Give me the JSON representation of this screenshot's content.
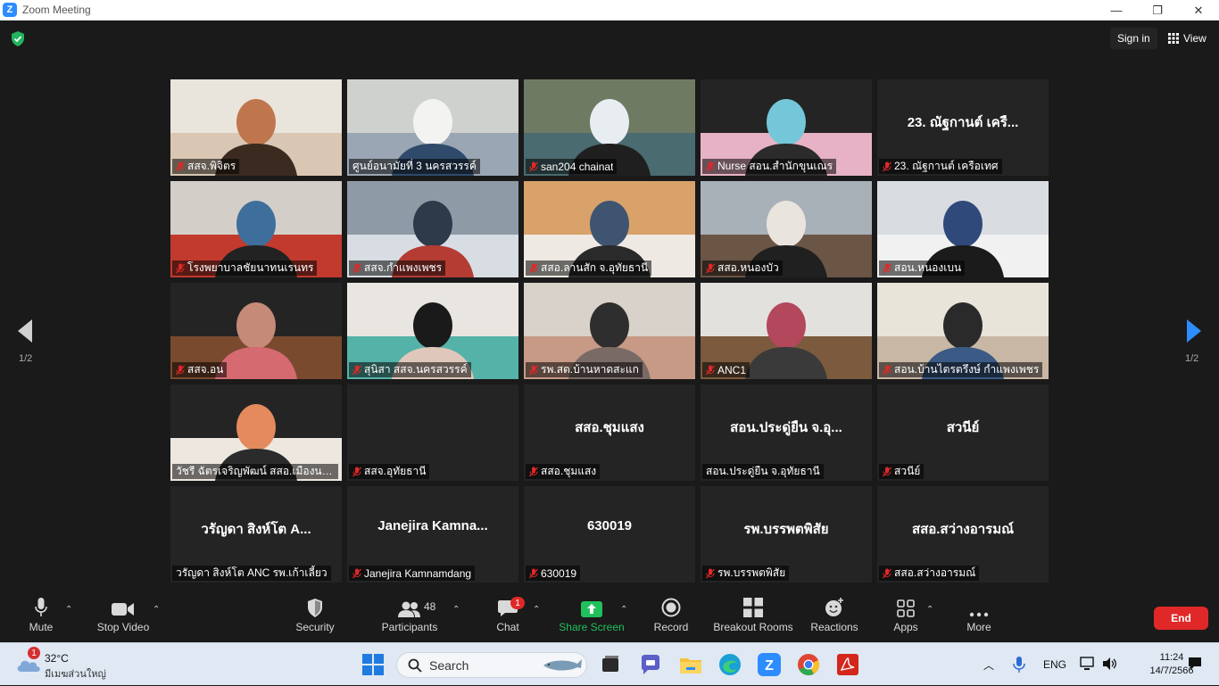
{
  "window": {
    "title": "Zoom Meeting",
    "controls": [
      "—",
      "❐",
      "✕"
    ]
  },
  "header": {
    "sign_in": "Sign in",
    "view": "View"
  },
  "pager": {
    "left": "1/2",
    "right": "1/2"
  },
  "participants": [
    {
      "label": "สสจ.พิจิตร",
      "muted": true,
      "video": true,
      "scene": "lady-office"
    },
    {
      "label": "ศูนย์อนามัยที่ 3 นครสวรรค์",
      "muted": false,
      "video": true,
      "scene": "meeting-room",
      "active": true
    },
    {
      "label": "san204 chainat",
      "muted": true,
      "video": true,
      "scene": "mask-lady"
    },
    {
      "label": "Nurse สอน.สำนักขุนเณร",
      "muted": true,
      "video": true,
      "scene": "nurse-blue"
    },
    {
      "label": "23. ณัฐกานต์ เครือเทศ",
      "muted": true,
      "video": false,
      "display_name": "23. ณัฐกานต์ เครื..."
    },
    {
      "label": "โรงพยาบาลชัยนาทนเรนทร",
      "muted": true,
      "video": true,
      "scene": "red-sofa"
    },
    {
      "label": "สสจ.กำแพงเพชร",
      "muted": true,
      "video": true,
      "scene": "conference"
    },
    {
      "label": "สสอ.ลานสัก จ.อุทัยธานี",
      "muted": true,
      "video": true,
      "scene": "orange-wall"
    },
    {
      "label": "สสอ.หนองบัว",
      "muted": true,
      "video": true,
      "scene": "glasses-lady"
    },
    {
      "label": "สอน.หนองเบน",
      "muted": true,
      "video": true,
      "scene": "two-ladies"
    },
    {
      "label": "สสจ.อน",
      "muted": true,
      "video": true,
      "scene": "shelf-lady"
    },
    {
      "label": "สุนิสา สสจ.นครสวรรค์",
      "muted": true,
      "video": true,
      "scene": "mask-young"
    },
    {
      "label": "รพ.สต.บ้านหาดสะแก",
      "muted": true,
      "video": true,
      "scene": "wave-lady"
    },
    {
      "label": "ANC1",
      "muted": true,
      "video": true,
      "scene": "bookshelf"
    },
    {
      "label": "สอน.บ้านไตรตรึงษ์ กำแพงเพชร",
      "muted": true,
      "video": true,
      "scene": "young-man"
    },
    {
      "label": "วัชรี ฉัตรเจริญพัฒน์ สสอ.เมืองนคร...",
      "muted": false,
      "video": true,
      "scene": "pink-lady"
    },
    {
      "label": "สสจ.อุทัยธานี",
      "muted": true,
      "video": false,
      "display_name": ""
    },
    {
      "label": "สสอ.ชุมแสง",
      "muted": true,
      "video": false,
      "display_name": "สสอ.ชุมแสง"
    },
    {
      "label": "สอน.ประดู่ยืน จ.อุทัยธานี",
      "muted": false,
      "video": false,
      "display_name": "สอน.ประดู่ยืน จ.อุ..."
    },
    {
      "label": "สวนีย์",
      "muted": true,
      "video": false,
      "display_name": "สวนีย์"
    },
    {
      "label": "วรัญดา สิงห์โต ANC รพ.เก้าเลี้ยว",
      "muted": false,
      "video": false,
      "display_name": "วรัญดา สิงห์โต A..."
    },
    {
      "label": "Janejira Kamnamdang",
      "muted": true,
      "video": false,
      "display_name": "Janejira  Kamna..."
    },
    {
      "label": "630019",
      "muted": true,
      "video": false,
      "display_name": "630019"
    },
    {
      "label": "รพ.บรรพตพิสัย",
      "muted": true,
      "video": false,
      "display_name": "รพ.บรรพตพิสัย"
    },
    {
      "label": "สสอ.สว่างอารมณ์",
      "muted": true,
      "video": false,
      "display_name": "สสอ.สว่างอารมณ์"
    }
  ],
  "toolbar": {
    "mute": "Mute",
    "stop_video": "Stop Video",
    "security": "Security",
    "participants": "Participants",
    "participants_count": "48",
    "chat": "Chat",
    "chat_badge": "1",
    "share_screen": "Share Screen",
    "record": "Record",
    "breakout_rooms": "Breakout Rooms",
    "reactions": "Reactions",
    "apps": "Apps",
    "more": "More",
    "end": "End",
    "share_color": "#21c05c",
    "end_color": "#e02828"
  },
  "taskbar": {
    "weather_temp": "32°C",
    "weather_desc": "มีเมฆส่วนใหญ่",
    "weather_badge": "1",
    "search_placeholder": "Search",
    "lang": "ENG",
    "time": "11:24",
    "date": "14/7/2566",
    "apps": [
      "windows-start",
      "task-view",
      "teams-chat",
      "file-explorer",
      "edge",
      "zoom",
      "chrome",
      "acrobat"
    ]
  }
}
